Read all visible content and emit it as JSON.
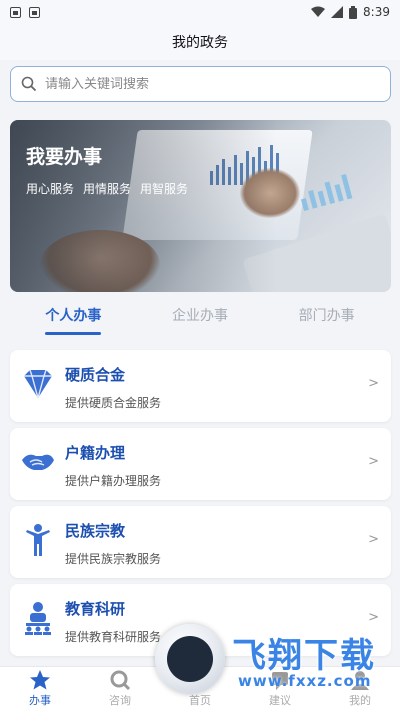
{
  "status_bar": {
    "time": "8:39"
  },
  "header": {
    "title": "我的政务"
  },
  "search": {
    "placeholder": "请输入关键词搜索"
  },
  "banner": {
    "title": "我要办事",
    "tags": [
      "用心服务",
      "用情服务",
      "用智服务"
    ]
  },
  "tabs": [
    {
      "label": "个人办事",
      "active": true
    },
    {
      "label": "企业办事",
      "active": false
    },
    {
      "label": "部门办事",
      "active": false
    }
  ],
  "services": [
    {
      "title": "硬质合金",
      "desc": "提供硬质合金服务",
      "icon": "diamond-icon",
      "arrow": ">"
    },
    {
      "title": "户籍办理",
      "desc": "提供户籍办理服务",
      "icon": "handshake-icon",
      "arrow": ">"
    },
    {
      "title": "民族宗教",
      "desc": "提供民族宗教服务",
      "icon": "person-icon",
      "arrow": ">"
    },
    {
      "title": "教育科研",
      "desc": "提供教育科研服务",
      "icon": "teacher-icon",
      "arrow": ">"
    }
  ],
  "bottom_nav": [
    {
      "label": "办事",
      "icon": "star-icon",
      "active": true
    },
    {
      "label": "咨询",
      "icon": "search-icon",
      "active": false
    },
    {
      "label": "首页",
      "icon": "home-icon",
      "active": false
    },
    {
      "label": "建议",
      "icon": "suggest-icon",
      "active": false
    },
    {
      "label": "我的",
      "icon": "user-icon",
      "active": false
    }
  ],
  "watermark": {
    "title": "飞翔下载",
    "url": "www.fxxz.com"
  },
  "colors": {
    "accent": "#2a63c7",
    "icon_blue": "#3b6fd1"
  }
}
